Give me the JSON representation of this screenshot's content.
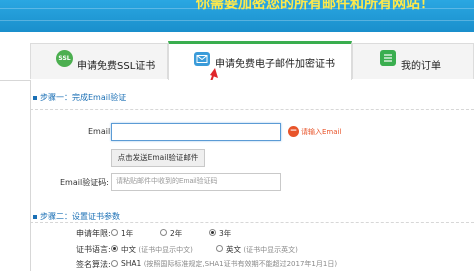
{
  "banner": {
    "title": "你需要加密您的所有邮件和所有网站！"
  },
  "tabs": [
    {
      "label": "申请免费SSL证书",
      "icon": "SSL"
    },
    {
      "label": "申请免费电子邮件加密证书"
    },
    {
      "label": "我的订单"
    }
  ],
  "step1": {
    "title": "步骤一：完成Email验证",
    "email_label": "Email:",
    "email_value": "",
    "email_error": "请输入Email",
    "send_button": "点击发送Email验证邮件",
    "code_label": "Email验证码:",
    "code_placeholder": "请粘贴邮件中收到的Email验证码"
  },
  "step2": {
    "title": "步骤二：设置证书参数",
    "years_label": "申请年限:",
    "years_options": [
      "1年",
      "2年",
      "3年"
    ],
    "years_selected": "3年",
    "lang_label": "证书语言:",
    "lang_options": [
      {
        "main": "中文",
        "hint": "(证书中显示中文)"
      },
      {
        "main": "英文",
        "hint": "(证书中显示英文)"
      }
    ],
    "lang_selected": "中文",
    "algo_label": "签名算法:",
    "algo_option": "SHA1",
    "algo_hint": "(按照国际标准规定,SHA1证书有效期不能超过2017年1月1日)"
  },
  "colors": {
    "banner": "#1f9bd6",
    "banner_title": "#ffe94a",
    "active_tab_accent": "#3aae4f",
    "section_title": "#1a6fb5",
    "error": "#e8542a",
    "arrow": "#e0262b"
  }
}
